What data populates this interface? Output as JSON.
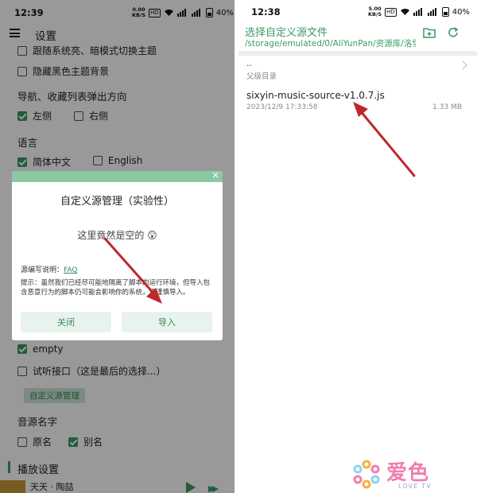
{
  "left": {
    "status": {
      "time": "12:39",
      "speed_top": "0.00",
      "speed_bottom": "KB/S",
      "hd": "HD",
      "battery": "40%"
    },
    "header": {
      "title": "设置"
    },
    "options": {
      "follow_system_theme": "跟随系统亮、暗模式切换主题",
      "hide_black_theme": "隐藏黑色主题背景",
      "nav_popup_label": "导航、收藏列表弹出方向",
      "left_side": "左侧",
      "right_side": "右侧",
      "language_label": "语言",
      "simplified_chinese": "简体中文",
      "english": "English",
      "empty": "empty",
      "trial_api": "试听接口（这是最后的选择...）",
      "custom_source_manage": "自定义源管理",
      "source_name_label": "音源名字",
      "original_name": "原名",
      "alias": "别名",
      "playback_settings": "播放设置"
    },
    "dialog": {
      "close_x": "×",
      "title": "自定义源管理（实验性）",
      "empty_text": "这里竟然是空的 😲",
      "help_prefix": "源编写说明：",
      "help_link": "FAQ",
      "tip": "提示：虽然我们已经尽可能地隔离了脚本的运行环境，但导入包含恶意行为的脚本仍可能会影响你的系统，请谨慎导入。",
      "close_button": "关闭",
      "import_button": "导入"
    },
    "player": {
      "song": "天天 · 陶喆"
    }
  },
  "right": {
    "status": {
      "time": "12:38",
      "speed_top": "5.00",
      "speed_bottom": "KB/S",
      "hd": "HD",
      "battery": "40%"
    },
    "header": {
      "title": "选择自定义源文件",
      "path": "/storage/emulated/0/AliYunPan/资源库/洛雪..."
    },
    "parent": {
      "up": "..",
      "label": "父级目录"
    },
    "file": {
      "name": "sixyin-music-source-v1.0.7.js",
      "date": "2023/12/9 17:33:58",
      "size": "1.33 MB"
    }
  },
  "watermark": {
    "text": "爱色",
    "sub": "LOVE TV"
  },
  "colors": {
    "accent": "#3a9a64",
    "dialog_header": "#8bc9a2",
    "arrow": "#c0272d"
  }
}
